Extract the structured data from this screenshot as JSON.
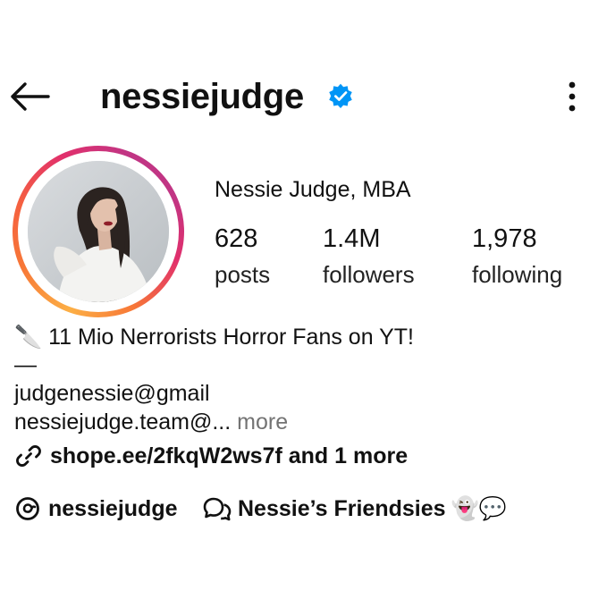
{
  "header": {
    "username": "nessiejudge",
    "verified": true,
    "icons": {
      "back": "back-arrow-icon",
      "verified": "verified-badge-icon",
      "menu": "more-vertical-icon"
    }
  },
  "profile": {
    "full_name": "Nessie Judge, MBA",
    "stats": [
      {
        "value": "628",
        "label": "posts"
      },
      {
        "value": "1.4M",
        "label": "followers"
      },
      {
        "value": "1,978",
        "label": "following"
      }
    ]
  },
  "bio": {
    "line1_emoji": "🔪",
    "line1_text": "11 Mio Nerrorists Horror Fans on YT!",
    "line2": "—",
    "line3": "judgenessie@gmail",
    "line4": "nessiejudge.team@...",
    "more_label": "more"
  },
  "links": {
    "text": "shope.ee/2fkqW2ws7f and 1 more",
    "icon": "link-icon"
  },
  "threads": {
    "handle": "nessiejudge",
    "icon": "threads-icon"
  },
  "channel": {
    "name": "Nessie’s Friendsies",
    "emoji": "👻💬",
    "icon": "broadcast-channel-icon"
  },
  "colors": {
    "verified_blue": "#0095f6",
    "muted_text": "#737373",
    "ring_gradient": [
      "#fcaf45",
      "#f56040",
      "#e1306c",
      "#c13584"
    ]
  }
}
